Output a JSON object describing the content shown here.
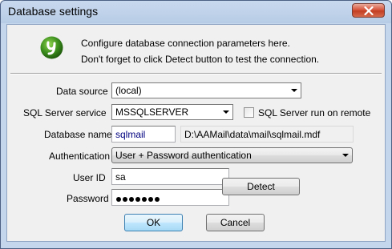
{
  "window": {
    "title": "Database settings"
  },
  "header": {
    "line1": "Configure database connection parameters here.",
    "line2": "Don't forget to click Detect button to test the connection.",
    "logo_icon": "green-app-logo-icon",
    "logo_color": "#3c8f1e"
  },
  "form": {
    "data_source": {
      "label": "Data source",
      "value": "(local)"
    },
    "sql_server_service": {
      "label": "SQL Server service",
      "value": "MSSQLSERVER"
    },
    "remote_checkbox": {
      "label": "SQL Server run on remote",
      "checked": false
    },
    "database_name": {
      "label": "Database name",
      "value": "sqlmail",
      "path": "D:\\AAMail\\data\\mail\\sqlmail.mdf"
    },
    "authentication": {
      "label": "Authentication",
      "value": "User + Password authentication"
    },
    "user_id": {
      "label": "User ID",
      "value": "sa"
    },
    "password": {
      "label": "Password",
      "length": 7
    }
  },
  "buttons": {
    "detect": "Detect",
    "ok": "OK",
    "cancel": "Cancel"
  },
  "colors": {
    "title_bar": "#b7cce6",
    "close_button": "#c9452b",
    "db_name_text": "#000080"
  }
}
